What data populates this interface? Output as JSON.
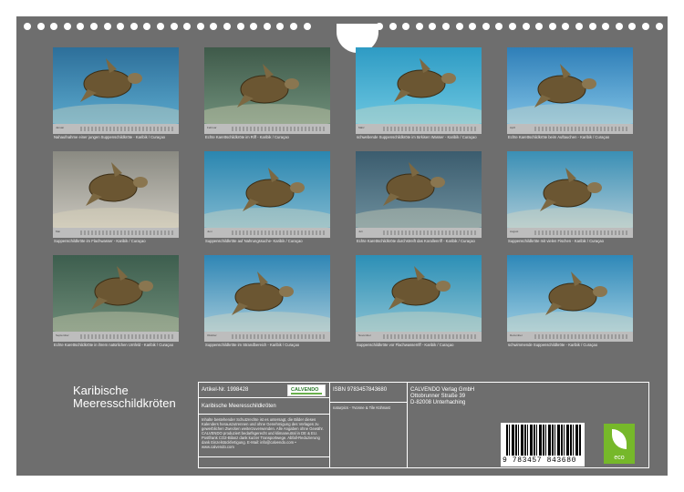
{
  "title": {
    "line1": "Karibische",
    "line2": "Meeresschildkröten"
  },
  "months": [
    {
      "label": "Januar",
      "caption": "Nahaufnahme einer jungen Suppenschildkröte - Karibik / Curaçao"
    },
    {
      "label": "Februar",
      "caption": "Echte Karettschildkröte im Riff - Karibik / Curaçao"
    },
    {
      "label": "März",
      "caption": "schwebende Suppenschildkröte im türkisen Wasser - Karibik / Curaçao"
    },
    {
      "label": "April",
      "caption": "Echte Karettschildkröte beim Auftauchen - Karibik / Curaçao"
    },
    {
      "label": "Mai",
      "caption": "Suppenschildkröte im Flachwasser - Karibik / Curaçao"
    },
    {
      "label": "Juni",
      "caption": "Suppenschildkröte auf Nahrungssuche- Karibik / Curaçao"
    },
    {
      "label": "Juli",
      "caption": "Echte Karettschildkröte durchstreift das Korallenriff - Karibik / Curaçao"
    },
    {
      "label": "August",
      "caption": "Suppenschildkröte mit vielen Fischen - Karibik / Curaçao"
    },
    {
      "label": "September",
      "caption": "Echte Karettschildkröte in ihrem natürlichen Umfeld - Karibik / Curaçao"
    },
    {
      "label": "Oktober",
      "caption": "Suppenschildkröte im Strandbereich - Karibik / Curaçao"
    },
    {
      "label": "November",
      "caption": "Suppenschildkröte vor Flachwasserriff - Karibik / Curaçao"
    },
    {
      "label": "Dezember",
      "caption": "schwimmende Suppenschildkröte - Karibik / Curaçao"
    }
  ],
  "info": {
    "artikel": "Artikel-Nr. 1998428",
    "publisher_logo": "CALVENDO",
    "product_title": "Karibische Meeresschildkröten",
    "legal_text": "Inhalte bestehender Schutzrechte ist es untersagt, die Bilder dieses Kalenders herauszutrennen und ohne Genehmigung des Verlages zu gewerblichen Zwecken weiterzuverwenden. Alle Angaben ohne Gewähr. CALVENDO produziert bedarfsgerecht und klimaneutral in DE & EU. Postfrank CO2-Bilanz dank kurzer Transportwege. Abfall-Reduzierung dank Einzelstückfertigung. E-Mail: info@calvendo.com • www.calvendo.com",
    "isbn": "ISBN 9783457843680",
    "author": "naturpics - Yvonne & Tile Kühnast",
    "publisher_lines": [
      "CALVENDO Verlag GmbH",
      "Ottobrunner Straße 39",
      "D-82008 Unterhaching"
    ],
    "barcode_number": "9 783457 843680",
    "eco_label": "eco"
  },
  "colors": {
    "board": "#6e6e6e",
    "water": "#3a8fbf",
    "eco_green": "#76b82a"
  }
}
